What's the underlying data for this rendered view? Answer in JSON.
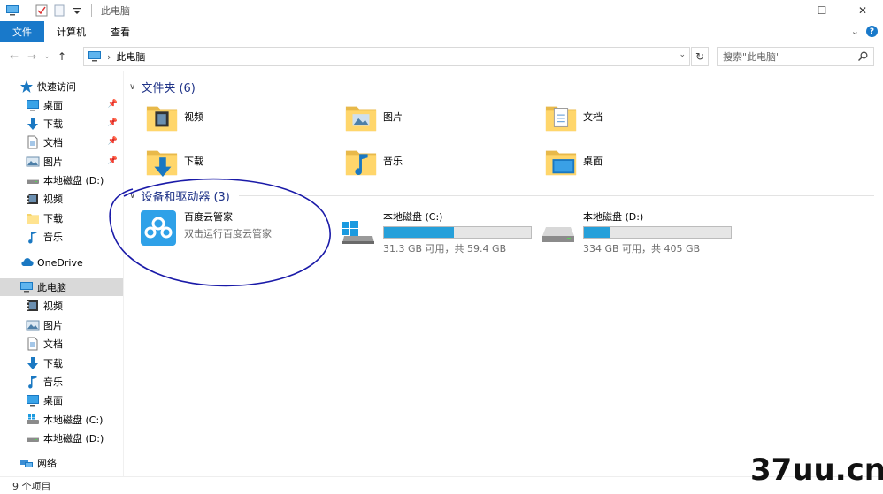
{
  "window": {
    "title": "此电脑",
    "controls": {
      "minimize": "—",
      "maximize": "☐",
      "close": "✕"
    }
  },
  "ribbon": {
    "tabs": [
      {
        "label": "文件",
        "active": true
      },
      {
        "label": "计算机",
        "active": false
      },
      {
        "label": "查看",
        "active": false
      }
    ],
    "collapse": "⌄",
    "help": "?"
  },
  "navigation": {
    "back": "←",
    "forward": "→",
    "recent": "⌄",
    "up": "↑",
    "address_separator": "›",
    "address": "此电脑",
    "refresh": "↻",
    "search_placeholder": "搜索\"此电脑\""
  },
  "sidebar": {
    "quick_access": {
      "label": "快速访问",
      "items": [
        {
          "label": "桌面",
          "icon": "desktop-icon",
          "pinned": true
        },
        {
          "label": "下载",
          "icon": "download-icon",
          "pinned": true
        },
        {
          "label": "文档",
          "icon": "document-icon",
          "pinned": true
        },
        {
          "label": "图片",
          "icon": "picture-icon",
          "pinned": true
        },
        {
          "label": "本地磁盘 (D:)",
          "icon": "drive-icon",
          "pinned": false
        },
        {
          "label": "视频",
          "icon": "video-icon",
          "pinned": false
        },
        {
          "label": "下载",
          "icon": "folder-icon",
          "pinned": false
        },
        {
          "label": "音乐",
          "icon": "music-icon",
          "pinned": false
        }
      ]
    },
    "onedrive": {
      "label": "OneDrive"
    },
    "this_pc": {
      "label": "此电脑",
      "items": [
        {
          "label": "视频",
          "icon": "video-icon"
        },
        {
          "label": "图片",
          "icon": "picture-icon"
        },
        {
          "label": "文档",
          "icon": "document-icon"
        },
        {
          "label": "下载",
          "icon": "download-icon"
        },
        {
          "label": "音乐",
          "icon": "music-icon"
        },
        {
          "label": "桌面",
          "icon": "desktop-icon"
        },
        {
          "label": "本地磁盘 (C:)",
          "icon": "windows-drive-icon"
        },
        {
          "label": "本地磁盘 (D:)",
          "icon": "drive-icon"
        }
      ]
    },
    "network": {
      "label": "网络"
    }
  },
  "content": {
    "folders_header": "文件夹 (6)",
    "folders": [
      {
        "label": "视频",
        "icon": "video-folder-icon"
      },
      {
        "label": "图片",
        "icon": "picture-folder-icon"
      },
      {
        "label": "文档",
        "icon": "document-folder-icon"
      },
      {
        "label": "下载",
        "icon": "download-folder-icon"
      },
      {
        "label": "音乐",
        "icon": "music-folder-icon"
      },
      {
        "label": "桌面",
        "icon": "desktop-folder-icon"
      }
    ],
    "devices_header": "设备和驱动器 (3)",
    "app": {
      "name": "百度云管家",
      "description": "双击运行百度云管家",
      "icon": "baidu-cloud-icon",
      "color": "#2fa1e8"
    },
    "drives": [
      {
        "name": "本地磁盘 (C:)",
        "size": "31.3 GB 可用，共 59.4 GB",
        "used_fraction": 0.473,
        "icon": "windows-drive-icon"
      },
      {
        "name": "本地磁盘 (D:)",
        "size": "334 GB 可用，共 405 GB",
        "used_fraction": 0.175,
        "icon": "drive-icon"
      }
    ]
  },
  "status": {
    "items_count": "9 个项目"
  },
  "watermark": {
    "text": "37uu.cn"
  },
  "colors": {
    "accent": "#1979ca",
    "section_header": "#1e3287",
    "drive_bar_fill": "#26a0da",
    "selection": "#d9d9d9",
    "annotation_stroke": "#1a1aa8"
  }
}
